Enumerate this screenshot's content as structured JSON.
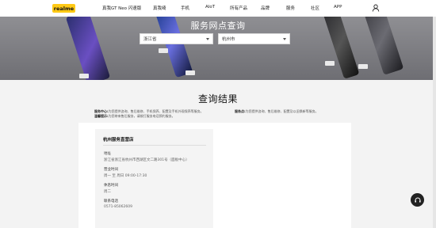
{
  "nav": {
    "logo": "realme",
    "items": [
      "真我GT Neo 闪速版",
      "真我绮",
      "手机",
      "AIoT",
      "所有产品",
      "品牌",
      "服务",
      "社区",
      "APP"
    ]
  },
  "hero": {
    "title": "服务网点查询",
    "province_select": "浙江省",
    "city_select": "杭州市"
  },
  "results": {
    "title": "查询结果",
    "note_left_label": "服务中心:",
    "note_left_text": "为您提供咨询、售后维修、手机保养、配置及手机外观保养等服务。",
    "note_left2_label": "温馨提示:",
    "note_left2_text": "为您带来售后服务，请拨打服务电话预约服务。",
    "note_right_label": "服务点:",
    "note_right_text": "为您提供咨询、售后维修、配置及以旧换新等服务。"
  },
  "store": {
    "name": "杭州服务直营店",
    "address_label": "地址",
    "address_value": "浙江省浙江省杭州市西湖区文二路301号（面板中心）",
    "hours_label": "营业时间",
    "hours_value": "周一 至 周日 09:00-17:30",
    "rest_label": "休息时间",
    "rest_value": "周二",
    "phone_label": "联系电话",
    "phone_value": "0571-85062609"
  },
  "colors": {
    "brand": "#ffc915",
    "hero_bg": "#7b7b80",
    "fab": "#222222"
  },
  "icons": {
    "user": "user-icon",
    "support": "headset-icon"
  }
}
